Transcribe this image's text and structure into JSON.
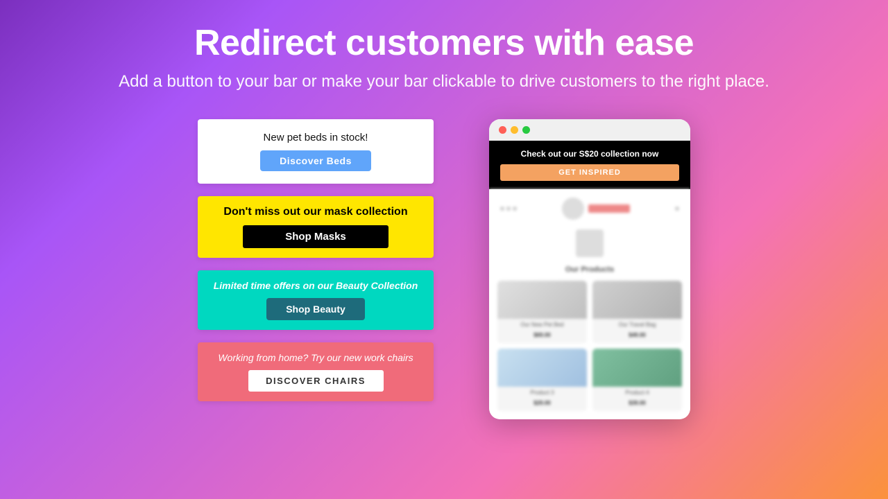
{
  "header": {
    "title": "Redirect customers with ease",
    "subtitle": "Add a button to your bar or make your bar clickable to drive customers to the right place."
  },
  "bars": [
    {
      "id": "bar-1",
      "text": "New pet beds in stock!",
      "button_label": "Discover Beds",
      "bg_color": "#FFFFFF",
      "btn_color": "#60A5FA"
    },
    {
      "id": "bar-2",
      "text": "Don't miss out our mask collection",
      "button_label": "Shop Masks",
      "bg_color": "#FFE600",
      "btn_color": "#000000"
    },
    {
      "id": "bar-3",
      "text": "Limited time offers on our Beauty Collection",
      "button_label": "Shop Beauty",
      "bg_color": "#00D8C0",
      "btn_color": "#1E6B7B"
    },
    {
      "id": "bar-4",
      "text": "Working from home? Try our new work chairs",
      "button_label": "DISCOVER CHAIRS",
      "bg_color": "#F06B7A",
      "btn_color": "#FFFFFF"
    }
  ],
  "browser_mockup": {
    "notification_text": "Check out our S$20 collection now",
    "notification_button": "GET INSPIRED",
    "products_title": "Our Products",
    "products": [
      {
        "name": "Our New Pet Bed",
        "price": "$69.00"
      },
      {
        "name": "Our Travel Bag",
        "price": "$49.00"
      },
      {
        "name": "Product 3",
        "price": "$29.00"
      },
      {
        "name": "Product 4",
        "price": "$39.00"
      }
    ]
  }
}
